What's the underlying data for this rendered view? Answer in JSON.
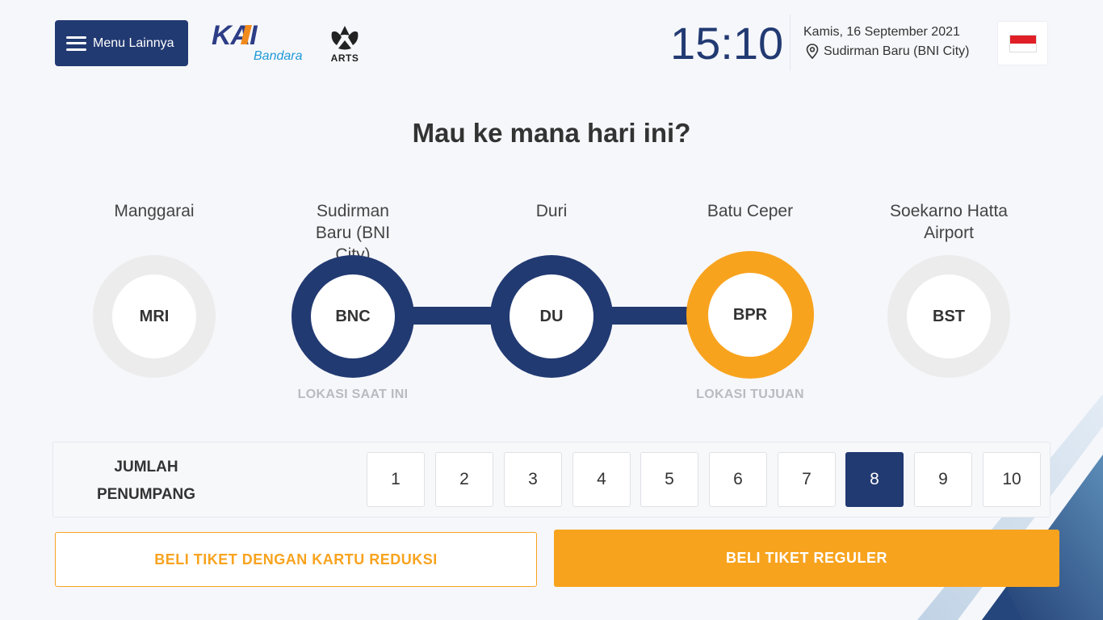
{
  "header": {
    "menu_label": "Menu Lainnya",
    "logo_kai_text": "KAI",
    "logo_kai_sub": "Bandara",
    "logo_arts_text": "ARTS",
    "time": "15:10",
    "date": "Kamis, 16 September 2021",
    "location": "Sudirman Baru (BNI City)",
    "language_flag": "indonesia-flag"
  },
  "title": "Mau ke mana hari ini?",
  "stations": [
    {
      "name": "Manggarai",
      "code": "MRI",
      "state": "inactive",
      "caption": ""
    },
    {
      "name": "Sudirman Baru (BNI City)",
      "code": "BNC",
      "state": "current",
      "caption": "LOKASI SAAT INI"
    },
    {
      "name": "Duri",
      "code": "DU",
      "state": "route",
      "caption": ""
    },
    {
      "name": "Batu Ceper",
      "code": "BPR",
      "state": "destination",
      "caption": "LOKASI TUJUAN"
    },
    {
      "name": "Soekarno Hatta Airport",
      "code": "BST",
      "state": "inactive",
      "caption": ""
    }
  ],
  "passengers": {
    "label": "JUMLAH PENUMPANG",
    "options": [
      "1",
      "2",
      "3",
      "4",
      "5",
      "6",
      "7",
      "8",
      "9",
      "10"
    ],
    "selected": "8"
  },
  "actions": {
    "reduksi_label": "BELI TIKET DENGAN KARTU REDUKSI",
    "reguler_label": "BELI TIKET REGULER"
  },
  "colors": {
    "navy": "#223a72",
    "orange": "#f8a31e",
    "inactive": "#ececec"
  }
}
